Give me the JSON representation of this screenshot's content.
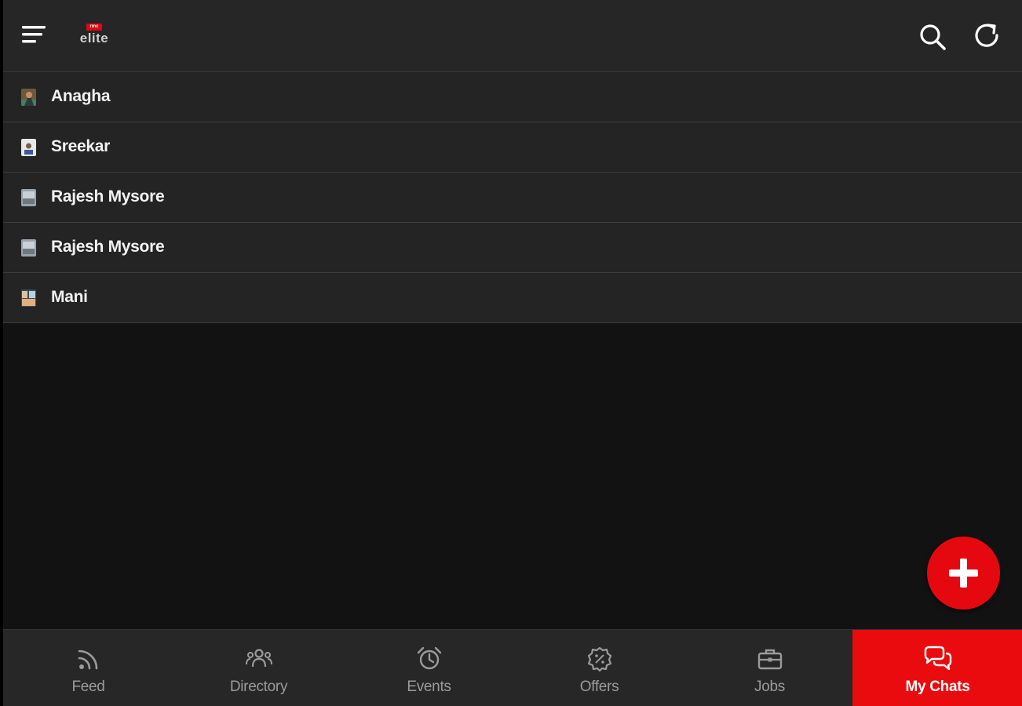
{
  "header": {
    "logo_badge": "rmc",
    "logo_text": "elite"
  },
  "icons": {
    "menu": "menu-icon",
    "search": "search-icon",
    "refresh": "refresh-icon",
    "add": "plus-icon"
  },
  "chats": [
    {
      "name": "Anagha"
    },
    {
      "name": "Sreekar"
    },
    {
      "name": "Rajesh Mysore"
    },
    {
      "name": "Rajesh Mysore"
    },
    {
      "name": "Mani"
    }
  ],
  "nav": [
    {
      "label": "Feed",
      "icon": "rss-icon"
    },
    {
      "label": "Directory",
      "icon": "people-icon"
    },
    {
      "label": "Events",
      "icon": "alarm-clock-icon"
    },
    {
      "label": "Offers",
      "icon": "discount-badge-icon"
    },
    {
      "label": "Jobs",
      "icon": "briefcase-icon"
    },
    {
      "label": "My Chats",
      "icon": "chat-bubbles-icon",
      "active": true
    }
  ],
  "colors": {
    "accent": "#e5090f",
    "topbar": "#262626",
    "row": "#242424",
    "background": "#121212",
    "nav_bg": "#272727"
  }
}
